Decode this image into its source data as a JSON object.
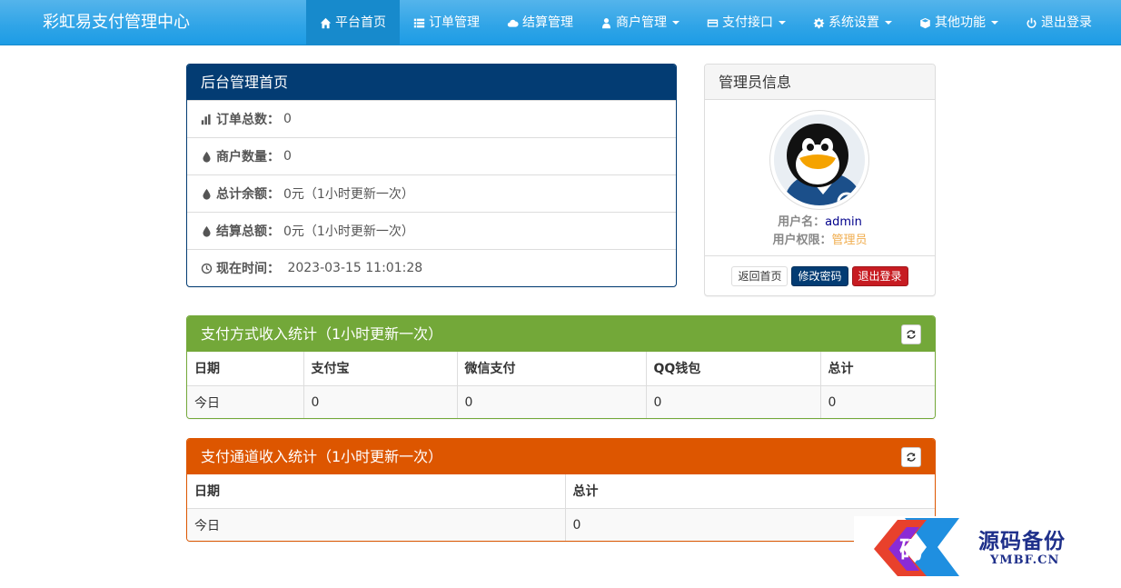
{
  "brand": "彩虹易支付管理中心",
  "nav": {
    "items": [
      {
        "label": "平台首页",
        "icon": "home-icon"
      },
      {
        "label": "订单管理",
        "icon": "list-icon"
      },
      {
        "label": "结算管理",
        "icon": "cloud-icon"
      },
      {
        "label": "商户管理",
        "icon": "user-icon"
      },
      {
        "label": "支付接口",
        "icon": "credit-card-icon"
      },
      {
        "label": "系统设置",
        "icon": "gear-icon"
      },
      {
        "label": "其他功能",
        "icon": "cube-icon"
      },
      {
        "label": "退出登录",
        "icon": "power-icon"
      }
    ]
  },
  "home": {
    "title": "后台管理首页",
    "rows": [
      {
        "label": "订单总数：",
        "value": "0",
        "icon": "bar-chart-icon"
      },
      {
        "label": "商户数量：",
        "value": "0",
        "icon": "tint-icon"
      },
      {
        "label": "总计余额：",
        "value": "0元（1小时更新一次）",
        "icon": "tint-icon"
      },
      {
        "label": "结算总额：",
        "value": "0元（1小时更新一次）",
        "icon": "tint-icon"
      },
      {
        "label": "现在时间：",
        "value": " 2023-03-15 11:01:28",
        "icon": "clock-icon"
      }
    ]
  },
  "admin": {
    "title": "管理员信息",
    "username_label": "用户名：",
    "username": "admin",
    "role_label": "用户权限：",
    "role": "管理员",
    "buttons": {
      "home": "返回首页",
      "password": "修改密码",
      "logout": "退出登录"
    }
  },
  "pay_stats": {
    "title": "支付方式收入统计（1小时更新一次）",
    "headers": [
      "日期",
      "支付宝",
      "微信支付",
      "QQ钱包",
      "总计"
    ],
    "rows": [
      [
        "今日",
        "0",
        "0",
        "0",
        "0"
      ]
    ]
  },
  "channel_stats": {
    "title": "支付通道收入统计（1小时更新一次）",
    "headers": [
      "日期",
      "总计"
    ],
    "rows": [
      [
        "今日",
        "0"
      ]
    ]
  },
  "watermark": {
    "title": "源码备份",
    "sub": "YMBF.CN"
  },
  "colors": {
    "navbar": "#2fa4e7",
    "primary": "#033c73",
    "success": "#73a839",
    "warning": "#dd5600",
    "danger": "#c71c22"
  }
}
